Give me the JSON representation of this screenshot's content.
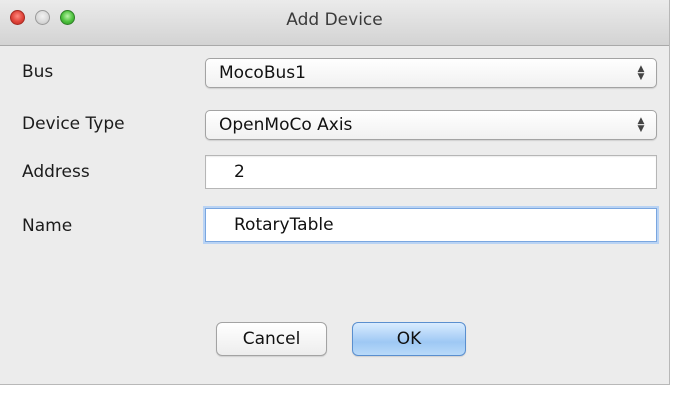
{
  "window": {
    "title": "Add Device"
  },
  "form": {
    "bus": {
      "label": "Bus",
      "value": "MocoBus1"
    },
    "device_type": {
      "label": "Device Type",
      "value": "OpenMoCo Axis"
    },
    "address": {
      "label": "Address",
      "value": "2"
    },
    "name": {
      "label": "Name",
      "value": "RotaryTable"
    }
  },
  "buttons": {
    "cancel": "Cancel",
    "ok": "OK"
  },
  "icons": {
    "close": "close-icon",
    "minimize": "minimize-icon",
    "zoom": "zoom-icon",
    "select_arrows": "up-down-arrows-icon"
  },
  "colors": {
    "window_bg": "#ececec",
    "close": "#e0443a",
    "zoom": "#4cc13c",
    "focus_ring": "#7aa6df",
    "ok_button": "#9ec8f4"
  }
}
